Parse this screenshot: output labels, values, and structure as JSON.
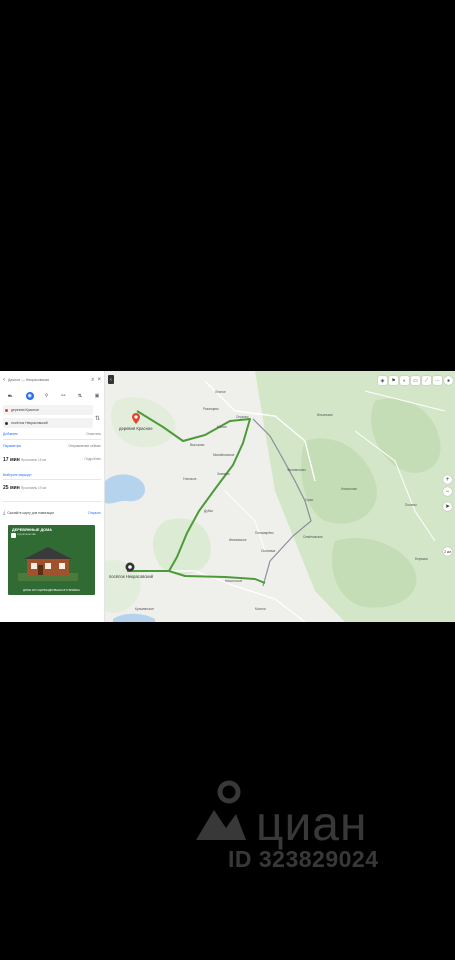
{
  "panel": {
    "search_text": "Дачное — Некрасовская",
    "modes": [
      "Авто",
      "Транспорт",
      "Пешком",
      "Вело",
      "Самокат",
      "Такси"
    ],
    "from": "деревня Красное",
    "to": "посёлок Некрасовский",
    "add_point": "Добавить",
    "departure": "Отправление сейчас",
    "settings": "Параметры",
    "clear": "Очистить",
    "route1": {
      "time": "17 мин",
      "meta": "Ярославль 15 км",
      "detail": "Подробнее"
    },
    "route1_link": "Выберите маршрут",
    "route2": {
      "time": "25 мин",
      "meta": "Ярославль 19 км"
    },
    "offline_text": "Скачайте карту для навигации",
    "offline_button": "Открыть",
    "ad": {
      "title": "ДЕРЕВЯННЫЕ ДОМА",
      "subtitle": "строительство",
      "bottom": "ДОМА ИЗ ОЦИЛИНДРОВАННОГО БРЕВНА"
    }
  },
  "map": {
    "destination_label": "деревня Красное",
    "origin_label": "посёлок Некрасовский",
    "labels": [
      "Лесное",
      "Рязанцево",
      "Серково",
      "Малое",
      "Высоково",
      "Михайловское",
      "Зимняки",
      "Глинское",
      "Дубки",
      "Ивановское",
      "Пономарёво",
      "Семёновское",
      "Горки",
      "Новоселки",
      "Филимоново",
      "Ильинское",
      "Осиновка",
      "Никольское",
      "Поляны",
      "Бережки",
      "Мостки",
      "Кузьминское"
    ],
    "scale": "2 км",
    "zoom_in": "+",
    "zoom_out": "−"
  },
  "watermark": {
    "brand": "циан",
    "id_text": "ID 323829024"
  },
  "colors": {
    "route_green": "#4e9a3a",
    "accent_blue": "#2a6ef0",
    "pin_red": "#e8442a",
    "forest": "#d3e6c7",
    "water": "#b6d3ee"
  }
}
